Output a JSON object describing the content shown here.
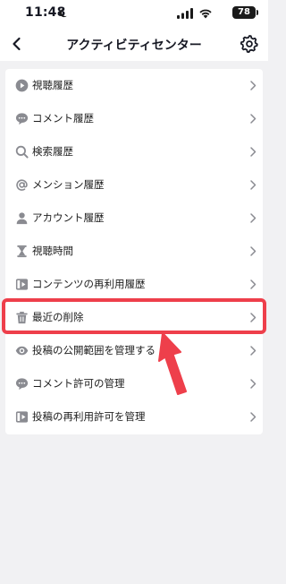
{
  "status_bar": {
    "time": "11:48",
    "battery": "78"
  },
  "header": {
    "title": "アクティビティセンター"
  },
  "menu": {
    "items": [
      {
        "label": "視聴履歴",
        "icon": "play-icon"
      },
      {
        "label": "コメント履歴",
        "icon": "comment-icon"
      },
      {
        "label": "検索履歴",
        "icon": "search-icon"
      },
      {
        "label": "メンション履歴",
        "icon": "at-icon"
      },
      {
        "label": "アカウント履歴",
        "icon": "person-icon"
      },
      {
        "label": "視聴時間",
        "icon": "hourglass-icon"
      },
      {
        "label": "コンテンツの再利用履歴",
        "icon": "video-reuse-icon"
      },
      {
        "label": "最近の削除",
        "icon": "trash-icon"
      },
      {
        "label": "投稿の公開範囲を管理する",
        "icon": "eye-icon"
      },
      {
        "label": "コメント許可の管理",
        "icon": "comment-icon"
      },
      {
        "label": "投稿の再利用許可を管理",
        "icon": "video-reuse-icon"
      }
    ]
  },
  "colors": {
    "highlight": "#ee3f4b",
    "icon": "#8a8b91",
    "background": "#f1f1f3"
  }
}
